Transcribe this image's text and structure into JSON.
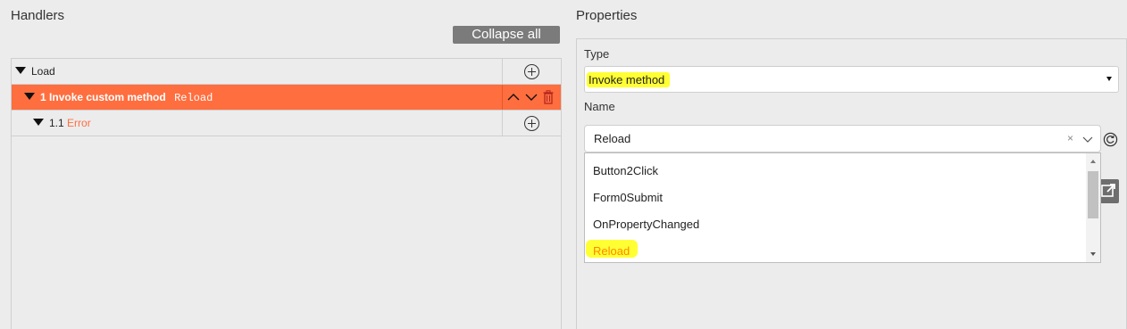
{
  "handlers": {
    "title": "Handlers",
    "collapse_all_label": "Collapse all",
    "tree": [
      {
        "label": "Load"
      },
      {
        "number": "1",
        "label": "Invoke custom method",
        "method": "Reload"
      },
      {
        "number": "1.1",
        "label": "Error"
      }
    ]
  },
  "properties": {
    "title": "Properties",
    "type_label": "Type",
    "type_value": "Invoke method",
    "name_label": "Name",
    "name_value": "Reload",
    "clear_glyph": "×",
    "options": [
      "Button2Click",
      "Form0Submit",
      "OnPropertyChanged",
      "Reload"
    ]
  },
  "colors": {
    "accent": "#ff6e3f",
    "highlight": "#ffff33",
    "selected_option": "#ff8a00"
  }
}
